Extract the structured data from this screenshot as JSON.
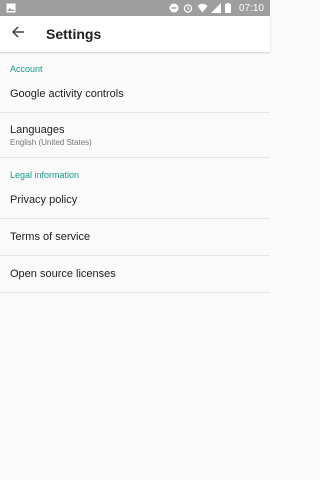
{
  "statusbar": {
    "time": "07:10",
    "colors": {
      "background": "#9e9e9e"
    },
    "icons": [
      "image-icon",
      "minus-circle-icon",
      "alarm-icon",
      "wifi-icon",
      "signal-icon",
      "battery-icon"
    ]
  },
  "toolbar": {
    "title": "Settings",
    "back_icon": "arrow-left-icon"
  },
  "sections": {
    "account": {
      "header": "Account",
      "items": {
        "google_activity": {
          "label": "Google activity controls"
        },
        "languages": {
          "label": "Languages",
          "subtitle": "English (United States)"
        }
      }
    },
    "legal": {
      "header": "Legal information",
      "items": {
        "privacy": {
          "label": "Privacy policy"
        },
        "terms": {
          "label": "Terms of service"
        },
        "licenses": {
          "label": "Open source licenses"
        }
      }
    }
  },
  "colors": {
    "accent": "#139b8a",
    "primary_text": "#212121",
    "secondary_text": "#757575"
  }
}
